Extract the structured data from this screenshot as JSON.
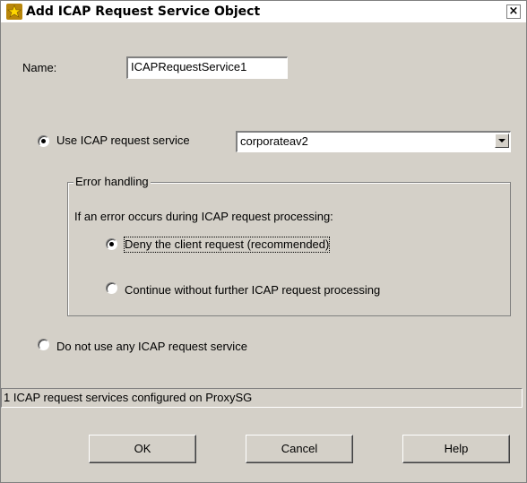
{
  "window": {
    "title": "Add ICAP Request Service Object",
    "close_label": "×"
  },
  "name_field": {
    "label": "Name:",
    "value": "ICAPRequestService1"
  },
  "use_service": {
    "label": "Use ICAP request service",
    "checked": true,
    "select": {
      "value": "corporateav2"
    }
  },
  "error_handling": {
    "title": "Error handling",
    "prompt": "If an error occurs during ICAP request processing:",
    "options": [
      {
        "label": "Deny the client request (recommended)",
        "checked": true
      },
      {
        "label": "Continue without further ICAP request processing",
        "checked": false
      }
    ]
  },
  "no_service": {
    "label": "Do not use any ICAP request service",
    "checked": false
  },
  "status": {
    "text": "1 ICAP request services configured on ProxySG"
  },
  "buttons": {
    "ok": "OK",
    "cancel": "Cancel",
    "help": "Help"
  }
}
